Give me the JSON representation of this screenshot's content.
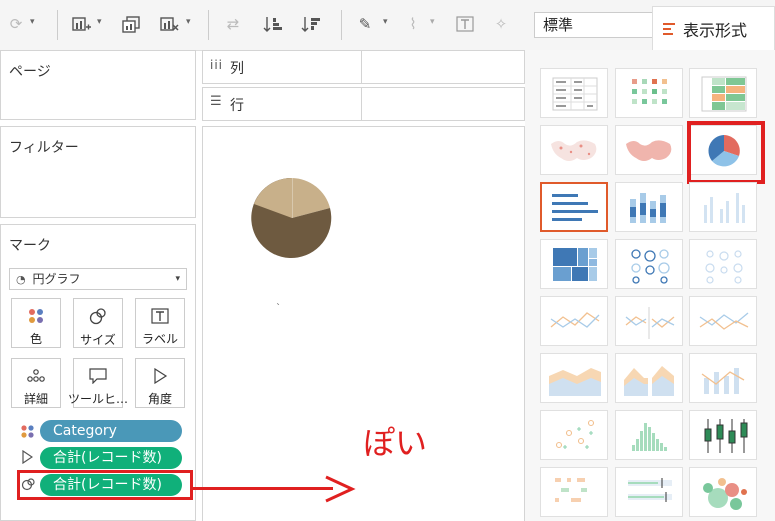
{
  "toolbar": {
    "icons": [
      "refresh-icon",
      "add-chart-icon",
      "duplicate-icon",
      "clear-chart-icon",
      "swap-icon",
      "sort-ascending-icon",
      "sort-descending-icon",
      "highlight-icon",
      "attach-icon",
      "text-box-icon",
      "pin-icon"
    ],
    "format_value": "標準"
  },
  "showme": {
    "tab_label": "表示形式",
    "accent": "#e05a2b",
    "selected_border": "#e02020"
  },
  "left": {
    "pages_title": "ページ",
    "filters_title": "フィルター",
    "marks_title": "マーク",
    "mark_type": "円グラフ",
    "mark_buttons": [
      {
        "label": "色",
        "icon": "color-dots-icon"
      },
      {
        "label": "サイズ",
        "icon": "size-icon"
      },
      {
        "label": "ラベル",
        "icon": "label-icon"
      },
      {
        "label": "詳細",
        "icon": "detail-icon"
      },
      {
        "label": "ツールヒ…",
        "icon": "tooltip-icon"
      },
      {
        "label": "角度",
        "icon": "angle-icon"
      }
    ],
    "pills": [
      {
        "text": "Category",
        "color": "#4a98b8",
        "icon": "color-dots-icon"
      },
      {
        "text": "合計(レコード数)",
        "color": "#10b07a",
        "icon": "angle-icon"
      },
      {
        "text": "合計(レコード数)",
        "color": "#10b07a",
        "icon": "size-icon"
      }
    ]
  },
  "shelves": {
    "columns": "列",
    "rows": "行"
  },
  "canvas": {
    "pie_colors": [
      "#c8b08a",
      "#6e5a40"
    ],
    "annotation": "ぽい",
    "annotation_color": "#e02020"
  }
}
